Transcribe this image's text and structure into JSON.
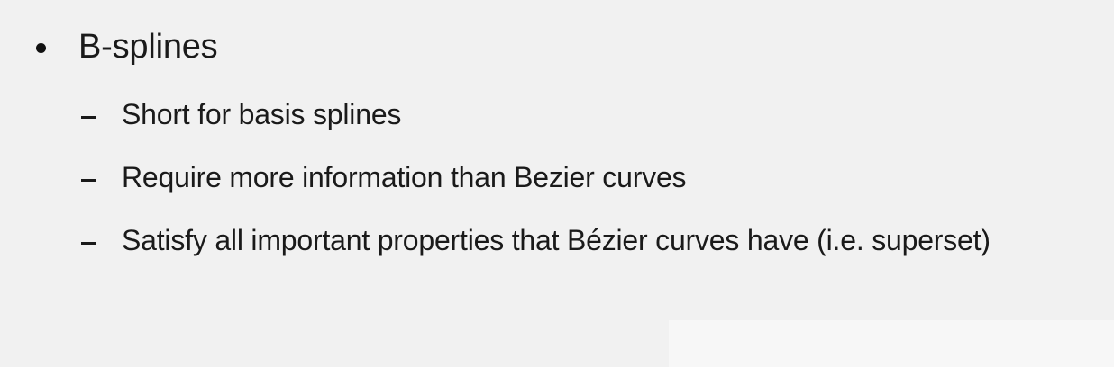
{
  "slide": {
    "main_bullet": "B-splines",
    "sub_bullets": [
      "Short for basis splines",
      "Require more information than Bezier curves",
      "Satisfy all important properties that Bézier curves have (i.e. superset)"
    ]
  },
  "colors": {
    "background": "#f1f1f1",
    "text": "#1a1a1a"
  }
}
